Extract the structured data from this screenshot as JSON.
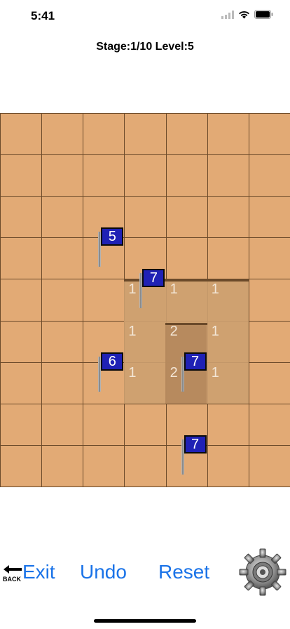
{
  "status_bar": {
    "time": "5:41"
  },
  "header": {
    "title": "Stage:1/10 Level:5"
  },
  "colors": {
    "tile": "#e2aa75",
    "grid_line": "#6b4a2a",
    "flag": "#1f21b5",
    "button_text": "#1a73e8"
  },
  "board": {
    "rows": 9,
    "cols": 7,
    "flags": [
      {
        "row": 3,
        "col": 2,
        "value": "5"
      },
      {
        "row": 4,
        "col": 3,
        "value": "7"
      },
      {
        "row": 6,
        "col": 2,
        "value": "6"
      },
      {
        "row": 6,
        "col": 4,
        "value": "7"
      },
      {
        "row": 8,
        "col": 4,
        "value": "7"
      }
    ],
    "numbers": [
      {
        "row": 4,
        "col": 3,
        "value": "1"
      },
      {
        "row": 4,
        "col": 4,
        "value": "1"
      },
      {
        "row": 4,
        "col": 5,
        "value": "1"
      },
      {
        "row": 5,
        "col": 3,
        "value": "1"
      },
      {
        "row": 5,
        "col": 4,
        "value": "2"
      },
      {
        "row": 5,
        "col": 5,
        "value": "1"
      },
      {
        "row": 6,
        "col": 3,
        "value": "1"
      },
      {
        "row": 6,
        "col": 4,
        "value": "2"
      },
      {
        "row": 6,
        "col": 5,
        "value": "1"
      }
    ]
  },
  "toolbar": {
    "back_label": "BACK",
    "exit_label": "Exit",
    "undo_label": "Undo",
    "reset_label": "Reset",
    "settings_icon": "gear-icon"
  }
}
